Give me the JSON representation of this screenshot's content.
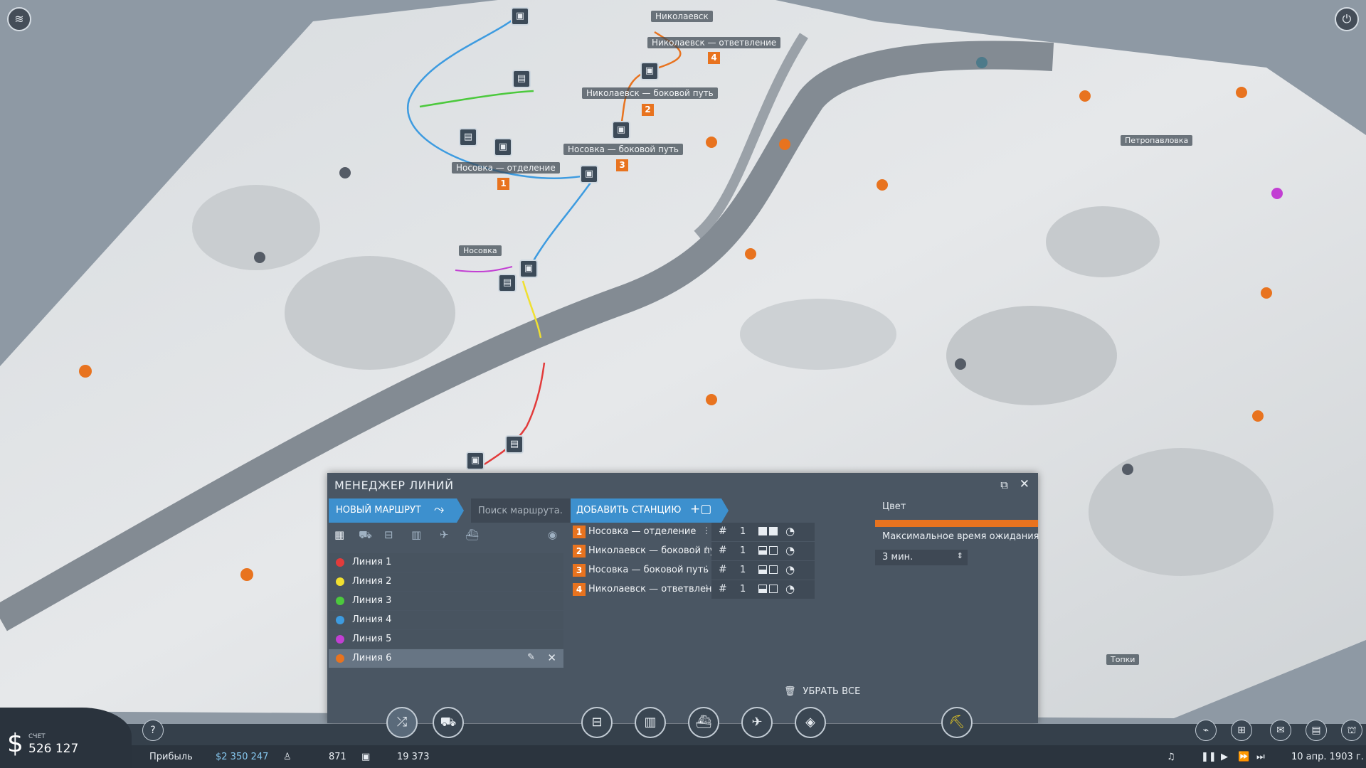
{
  "map": {
    "labels": [
      "Николаевск",
      "Николаевск — ответвление",
      "Николаевск — боковой путь",
      "Носовка — боковой путь",
      "Носовка — отделение",
      "Носовка",
      "Петропавловка",
      "Топки"
    ],
    "station_numbers": [
      "4",
      "2",
      "3",
      "1"
    ]
  },
  "window": {
    "title": "МЕНЕДЖЕР ЛИНИЙ",
    "new_route_label": "НОВЫЙ МАРШРУТ",
    "search_placeholder": "Поиск маршрута...",
    "add_station_label": "ДОБАВИТЬ СТАНЦИЮ",
    "lines": [
      {
        "name": "Линия 1",
        "color": "#e23b3b"
      },
      {
        "name": "Линия 2",
        "color": "#f0e030"
      },
      {
        "name": "Линия 3",
        "color": "#4cc93d"
      },
      {
        "name": "Линия 4",
        "color": "#3d9be0"
      },
      {
        "name": "Линия 5",
        "color": "#c23fd3"
      },
      {
        "name": "Линия 6",
        "color": "#e8731f"
      }
    ],
    "selected_line": "Линия 6",
    "stations": [
      {
        "num": "1",
        "name": "Носовка — отделение",
        "value": "1"
      },
      {
        "num": "2",
        "name": "Николаевск — боковой путь",
        "value": "1"
      },
      {
        "num": "3",
        "name": "Носовка — боковой путь",
        "value": "1"
      },
      {
        "num": "4",
        "name": "Николаевск — ответвление",
        "value": "1"
      }
    ],
    "color_label": "Цвет",
    "line_color": "#e8731f",
    "wait_label": "Максимальное время ожидания",
    "wait_value": "3 мин.",
    "remove_all_label": "УБРАТЬ ВСЕ"
  },
  "bottom": {
    "account_label": "СЧЕТ",
    "account_value": "526 127",
    "profit_label": "Прибыль",
    "profit_value": "$2 350 247",
    "population_value": "871",
    "cargo_value": "19 373",
    "date": "10 апр. 1903 г."
  },
  "icons": {
    "help": "help-icon",
    "lines": "lines-icon",
    "vehicles": "vehicle-manager-icon",
    "road": "road-icon",
    "rail": "rail-icon",
    "ship": "ship-icon",
    "air": "air-icon",
    "terrain": "terrain-icon",
    "bulldoze": "bulldozer-icon"
  }
}
